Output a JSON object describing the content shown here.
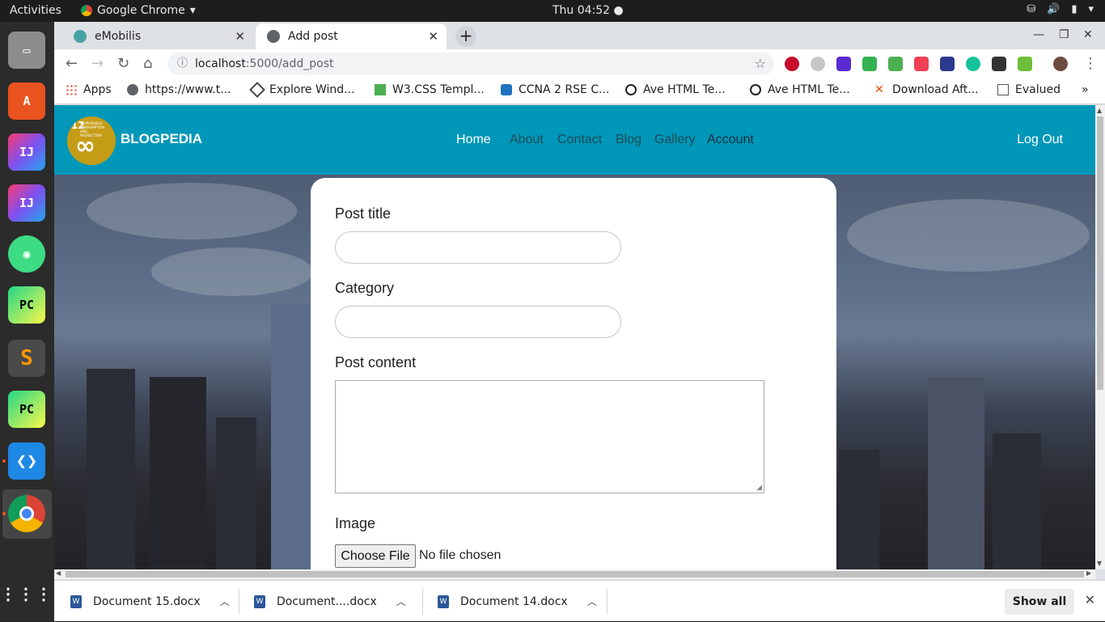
{
  "os": {
    "activities_label": "Activities",
    "app_label": "Google Chrome",
    "clock": "Thu 04:52",
    "tray_icons": [
      "network-icon",
      "volume-icon",
      "battery-icon",
      "power-menu-icon"
    ]
  },
  "dock": {
    "items": [
      "files-icon",
      "software-center-icon",
      "intellij-icon",
      "intellij-ce-icon",
      "android-studio-icon",
      "pycharm-icon",
      "sublime-text-icon",
      "pycharm-ce-icon",
      "vscode-icon",
      "chrome-icon",
      "app-grid-icon"
    ]
  },
  "browser": {
    "tabs": [
      {
        "title": "eMobilis",
        "active": false
      },
      {
        "title": "Add post",
        "active": true
      }
    ],
    "url_host": "localhost",
    "url_rest": ":5000/add_post",
    "bookmarks": [
      {
        "label": "Apps"
      },
      {
        "label": "https://www.t..."
      },
      {
        "label": "Explore Wind..."
      },
      {
        "label": "W3.CSS Templ..."
      },
      {
        "label": "CCNA 2 RSE C..."
      },
      {
        "label": "Ave HTML Te..."
      },
      {
        "label": "Ave HTML Te..."
      },
      {
        "label": "Download Aft..."
      },
      {
        "label": "Evalued"
      }
    ],
    "bookmarks_more": "»"
  },
  "site": {
    "logo": {
      "number": "12",
      "caption": "RESPONSIBLE CONSUMPTION AND PRODUCTION",
      "symbol": "∞"
    },
    "brand": "BLOGPEDIA",
    "nav": [
      "Home",
      "About",
      "Contact",
      "Blog",
      "Gallery",
      "Account"
    ],
    "logout": "Log Out"
  },
  "form": {
    "post_title_label": "Post title",
    "post_title_value": "",
    "category_label": "Category",
    "category_value": "",
    "content_label": "Post content",
    "content_value": "",
    "image_label": "Image",
    "choose_file_label": "Choose File",
    "no_file_text": "No file chosen"
  },
  "downloads": {
    "items": [
      {
        "name": "Document 15.docx"
      },
      {
        "name": "Document....docx"
      },
      {
        "name": "Document 14.docx"
      }
    ],
    "show_all": "Show all"
  }
}
